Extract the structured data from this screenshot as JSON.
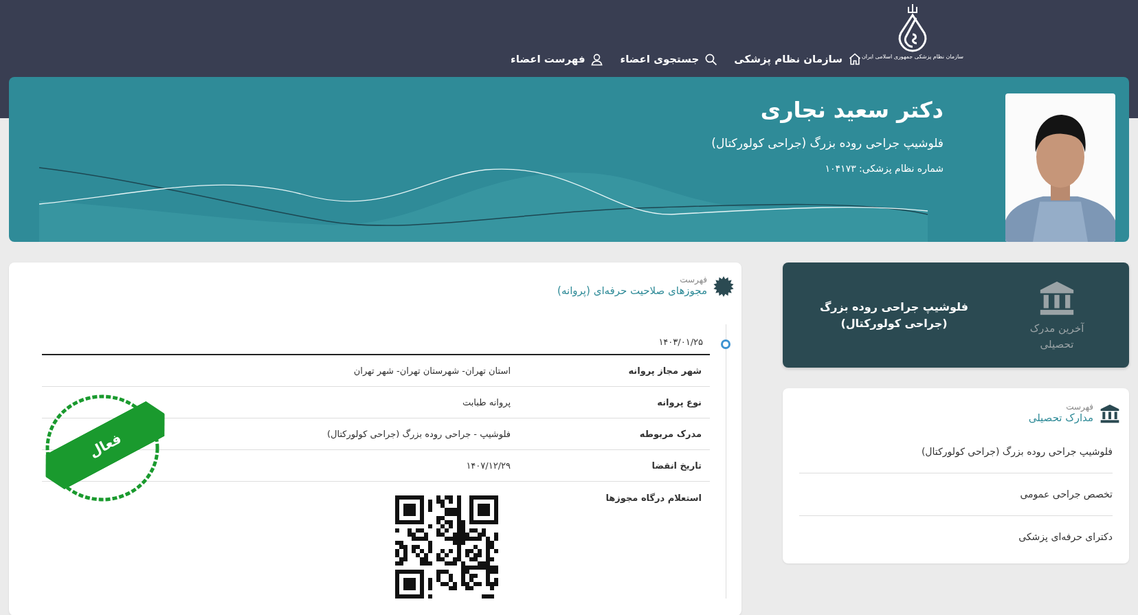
{
  "header": {
    "logo_caption": "سازمان نظام پزشکی جمهوری اسلامی ایران",
    "nav": [
      {
        "label": "سازمان نظام پزشکی",
        "kind": "home"
      },
      {
        "label": "جستجوی اعضاء",
        "kind": "search"
      },
      {
        "label": "فهرست اعضاء",
        "kind": "members"
      }
    ]
  },
  "profile": {
    "name": "دکتر سعید نجاری",
    "specialty": "فلوشیپ جراحی روده بزرگ (جراحی کولورکتال)",
    "number": "شماره نظام پزشکی: ۱۰۴۱۷۳"
  },
  "latest_degree": {
    "label": "آخرین مدرک تحصیلی",
    "value": "فلوشیپ جراحی روده بزرگ (جراحی کولورکتال)"
  },
  "education": {
    "caption": "فهرست",
    "title": "مدارک تحصیلی",
    "items": [
      "فلوشیپ جراحی روده بزرگ (جراحی کولورکتال)",
      "تخصص جراحی عمومی",
      "دکترای حرفه‌ای پزشکی"
    ]
  },
  "licenses": {
    "caption": "فهرست",
    "title": "مجوزهای صلاحیت حرفه‌ای (پروانه)",
    "entries": [
      {
        "date": "۱۴۰۳/۰۱/۲۵",
        "status": "فعال",
        "fields": [
          {
            "label": "شهر مجاز پروانه",
            "value": "استان تهران- شهرستان تهران- شهر تهران"
          },
          {
            "label": "نوع پروانه",
            "value": "پروانه طبابت"
          },
          {
            "label": "مدرک مربوطه",
            "value": "فلوشیپ - جراحی روده بزرگ (جراحی کولورکتال)"
          },
          {
            "label": "تاریخ انقضا",
            "value": "۱۴۰۷/۱۲/۲۹"
          }
        ],
        "inquiry_label": "استعلام درگاه مجوزها"
      }
    ]
  }
}
